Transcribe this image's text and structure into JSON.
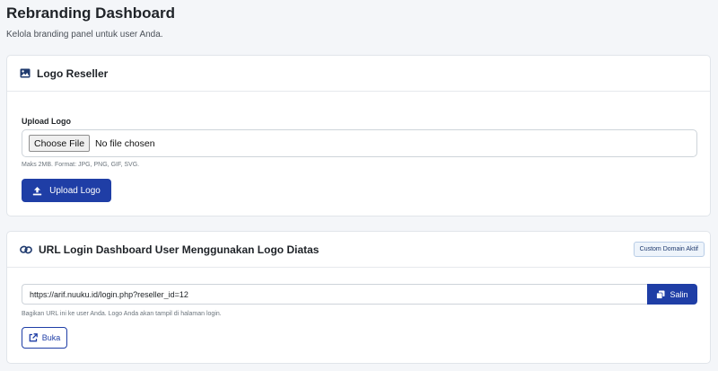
{
  "page": {
    "title": "Rebranding Dashboard",
    "subtitle": "Kelola branding panel untuk user Anda."
  },
  "logo_card": {
    "title": "Logo Reseller",
    "icon": "image-icon",
    "field_label": "Upload Logo",
    "choose_file_label": "Choose File",
    "file_status": "No file chosen",
    "help_text": "Maks 2MB. Format: JPG, PNG, GIF, SVG.",
    "upload_button_label": "Upload Logo"
  },
  "url_card": {
    "title": "URL Login Dashboard User Menggunakan Logo Diatas",
    "icon": "link-icon",
    "badge": "Custom Domain Aktif",
    "url_value": "https://arif.nuuku.id/login.php?reseller_id=12",
    "copy_button_label": "Salin",
    "help_text": "Bagikan URL ini ke user Anda. Logo Anda akan tampil di halaman login.",
    "open_button_label": "Buka"
  },
  "colors": {
    "primary": "#1f3ea6",
    "background": "#f4f6f9"
  }
}
